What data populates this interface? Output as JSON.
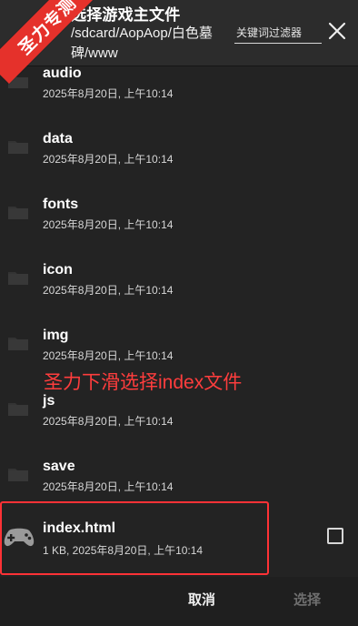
{
  "header": {
    "title": "选择游戏主文件",
    "path": "/sdcard/AopAop/白色墓碑/www",
    "filter_placeholder": "关键词过滤器"
  },
  "watermark": "圣力专测",
  "annotation": "圣力下滑选择index文件",
  "list": {
    "items": [
      {
        "name": "audio",
        "meta": "2025年8月20日, 上午10:14",
        "icon": "folder-icon"
      },
      {
        "name": "data",
        "meta": "2025年8月20日, 上午10:14",
        "icon": "folder-icon"
      },
      {
        "name": "fonts",
        "meta": "2025年8月20日, 上午10:14",
        "icon": "folder-icon"
      },
      {
        "name": "icon",
        "meta": "2025年8月20日, 上午10:14",
        "icon": "folder-icon"
      },
      {
        "name": "img",
        "meta": "2025年8月20日, 上午10:14",
        "icon": "folder-icon"
      },
      {
        "name": "js",
        "meta": "2025年8月20日, 上午10:14",
        "icon": "folder-icon"
      },
      {
        "name": "save",
        "meta": "2025年8月20日, 上午10:14",
        "icon": "folder-icon"
      },
      {
        "name": "index.html",
        "meta": "1 KB, 2025年8月20日, 上午10:14",
        "icon": "gamepad-icon"
      }
    ]
  },
  "footer": {
    "cancel_label": "取消",
    "select_label": "选择"
  },
  "colors": {
    "background": "#232323",
    "accent_red": "#ff3236",
    "text_dim": "#d7d7d7",
    "disabled_text": "#6f6f6f"
  }
}
